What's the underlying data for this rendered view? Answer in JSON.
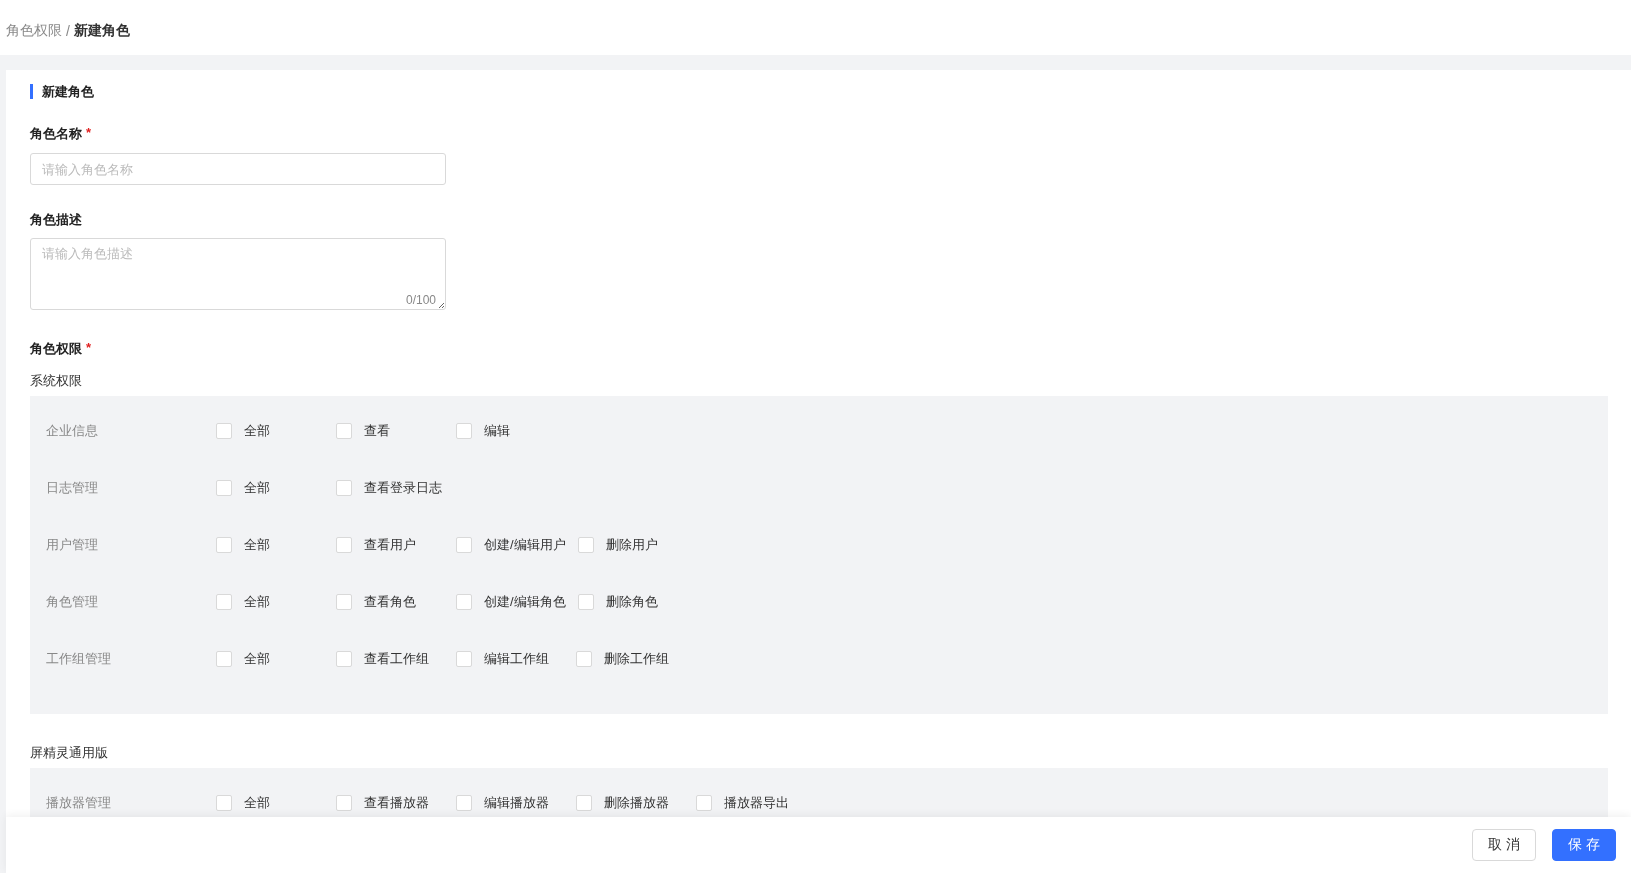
{
  "breadcrumb": {
    "separator": "/",
    "items": [
      {
        "label": "角色权限",
        "current": false
      },
      {
        "label": "新建角色",
        "current": true
      }
    ]
  },
  "card_title": "新建角色",
  "fields": [
    {
      "kind": "input",
      "label": "角色名称",
      "required_mark": "*",
      "placeholder": "请输入角色名称"
    },
    {
      "kind": "textarea",
      "label": "角色描述",
      "placeholder": "请输入角色描述",
      "counter": "0/100"
    }
  ],
  "permissions": {
    "label": "角色权限",
    "required_mark": "*",
    "sections": [
      {
        "title": "系统权限",
        "groups": [
          {
            "name": "企业信息",
            "options": [
              {
                "label": "全部",
                "checked": false
              },
              {
                "label": "查看",
                "checked": false
              },
              {
                "label": "编辑",
                "checked": false
              }
            ]
          },
          {
            "name": "日志管理",
            "options": [
              {
                "label": "全部",
                "checked": false
              },
              {
                "label": "查看登录日志",
                "checked": false
              }
            ]
          },
          {
            "name": "用户管理",
            "options": [
              {
                "label": "全部",
                "checked": false
              },
              {
                "label": "查看用户",
                "checked": false
              },
              {
                "label": "创建/编辑用户",
                "checked": false
              },
              {
                "label": "删除用户",
                "checked": false
              }
            ]
          },
          {
            "name": "角色管理",
            "options": [
              {
                "label": "全部",
                "checked": false
              },
              {
                "label": "查看角色",
                "checked": false
              },
              {
                "label": "创建/编辑角色",
                "checked": false
              },
              {
                "label": "删除角色",
                "checked": false
              }
            ]
          },
          {
            "name": "工作组管理",
            "options": [
              {
                "label": "全部",
                "checked": false
              },
              {
                "label": "查看工作组",
                "checked": false
              },
              {
                "label": "编辑工作组",
                "checked": false
              },
              {
                "label": "删除工作组",
                "checked": false
              }
            ]
          }
        ]
      },
      {
        "title": "屏精灵通用版",
        "groups": [
          {
            "name": "播放器管理",
            "options": [
              {
                "label": "全部",
                "checked": false
              },
              {
                "label": "查看播放器",
                "checked": false
              },
              {
                "label": "编辑播放器",
                "checked": false
              },
              {
                "label": "删除播放器",
                "checked": false
              },
              {
                "label": "播放器导出",
                "checked": false
              }
            ]
          }
        ]
      }
    ]
  },
  "footer_buttons": [
    {
      "kind": "secondary",
      "label": "取 消"
    },
    {
      "kind": "primary",
      "label": "保 存"
    }
  ]
}
